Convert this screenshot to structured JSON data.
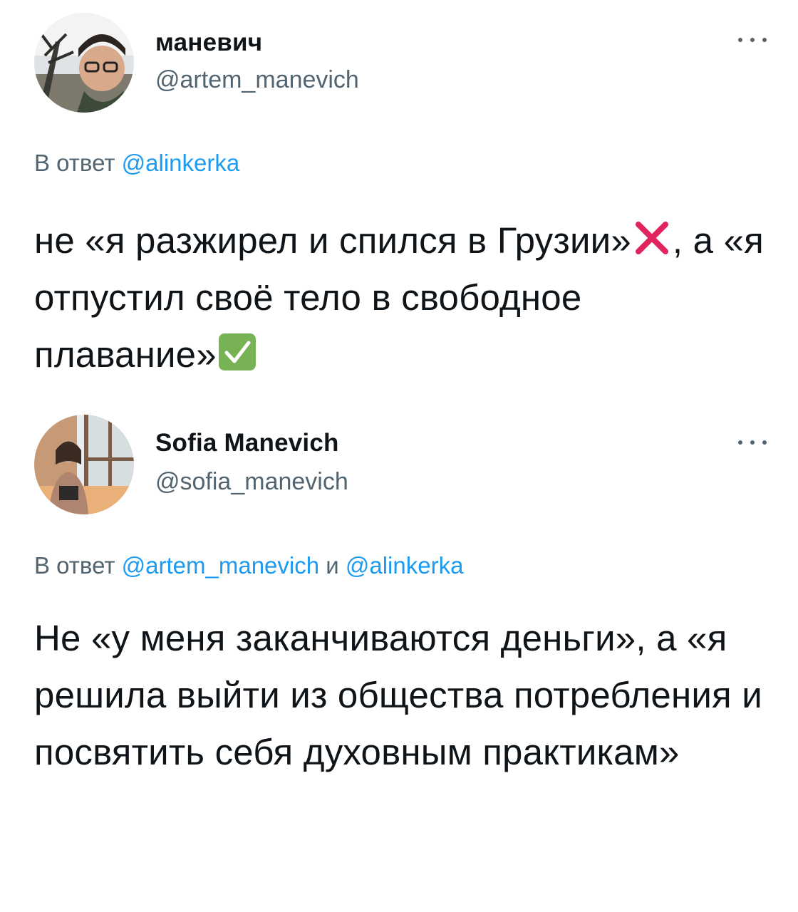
{
  "tweets": [
    {
      "display_name": "маневич",
      "handle": "@artem_manevich",
      "reply_prefix": "В ответ",
      "reply_mentions": [
        "@alinkerka"
      ],
      "reply_joiner": "",
      "text_parts": [
        "не «я разжирел и спился в Грузии»",
        ", а «я отпустил своё тело в свободное плавание»"
      ],
      "emojis": [
        "cross-mark-emoji",
        "check-mark-button-emoji"
      ]
    },
    {
      "display_name": "Sofia Manevich",
      "handle": "@sofia_manevich",
      "reply_prefix": "В ответ",
      "reply_mentions": [
        "@artem_manevich",
        "@alinkerka"
      ],
      "reply_joiner": "и",
      "text": "Не «у меня заканчиваются деньги», а «я решила выйти из общества потребления и посвятить себя духовным практикам»"
    }
  ],
  "icons": {
    "more": "more-horizontal-icon"
  },
  "colors": {
    "text": "#0f1419",
    "secondary": "#536471",
    "link": "#1d9bf0",
    "cross": "#e0245e",
    "check": "#77b255"
  }
}
